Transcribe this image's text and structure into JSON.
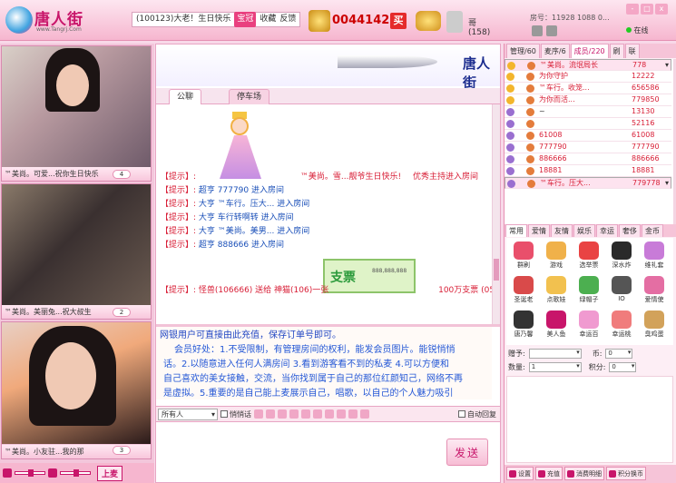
{
  "header": {
    "logo_text": "唐人街",
    "logo_url": "www.Tangrj.Com",
    "notice": "(100123)大老！生日快乐",
    "notice_btn": "宝冠",
    "links": [
      "收藏",
      "反馈"
    ],
    "money": "004414282",
    "buy": "买",
    "username": "哥 (158)",
    "room_info": "房号：11928 1088 0...",
    "status": "在线",
    "win": [
      "-",
      "□",
      "x"
    ]
  },
  "videos": [
    {
      "caption": "™美尚。可爱...祝你生日快乐",
      "count": "4"
    },
    {
      "caption": "™美尚。美丽兔...祝大叔生",
      "count": "2"
    },
    {
      "caption": "™美尚。小友驻...我的那",
      "count": "3"
    }
  ],
  "controls": {
    "mic": "上麦"
  },
  "banner": {
    "title": "唐人街"
  },
  "tabs": [
    "公聊",
    "停车场"
  ],
  "chat": [
    {
      "tip": "【提示】:",
      "text": "™美尚。雪...靓爷生日快乐!",
      "tail": "优秀主持进入房间"
    },
    {
      "tip": "【提示】:",
      "text": "超亨 777790 进入房间"
    },
    {
      "tip": "【提示】:",
      "text": "大亨 ™车行。压大... 进入房间"
    },
    {
      "tip": "【提示】:",
      "text": "大亨 车行转啊转 进入房间"
    },
    {
      "tip": "【提示】:",
      "text": "大亨 ™美尚。美男... 进入房间"
    },
    {
      "tip": "【提示】:",
      "text": "超亨 888666 进入房间"
    },
    {
      "tip": "【提示】:",
      "text": "怪兽(106666) 送给 神猫(106)一张",
      "tail": "100万支票 (05.09 01:45)"
    }
  ],
  "check": {
    "title": "支票",
    "num": "888,888,888"
  },
  "board": {
    "head": "网银用户可直接由此充值，保存订单号即可。",
    "body": [
      "会员好处：1.不受限制，有管理房间的权利，能发会员图片。能锐悄悄",
      "话。2.以随意进入任何人满房间 3.看到游客看不到的私麦 4.可以方便和",
      "自己喜欢的美女接触，交流，当你找到属于自己的那位红颜知己，网络不再",
      "是虚拟。5.重要的是自己能上麦展示自己，唱歌，以自己的个人魅力吸引"
    ]
  },
  "toolbar": {
    "target": "所有人",
    "whisper": "悄悄话",
    "auto": "自动回复"
  },
  "send": "发送",
  "right": {
    "tabs": [
      "管理/60",
      "麦序/6",
      "成员/220",
      "刷",
      "联"
    ],
    "users": [
      {
        "name": "™美尚。流氓局长",
        "id": "778",
        "sel": true
      },
      {
        "name": "为你守护",
        "id": "12222"
      },
      {
        "name": "™车行。收笼...",
        "id": "656586"
      },
      {
        "name": "为你而活...",
        "id": "779850"
      },
      {
        "name": "~",
        "id": "13130",
        "black": true
      },
      {
        "name": "",
        "id": "52116"
      },
      {
        "name": "61008",
        "id": "61008"
      },
      {
        "name": "777790",
        "id": "777790"
      },
      {
        "name": "886666",
        "id": "886666"
      },
      {
        "name": "18881",
        "id": "18881"
      },
      {
        "name": "™车行。压大...",
        "id": "779778",
        "sel": true
      }
    ],
    "gift_tabs": [
      "常用",
      "爱情",
      "友情",
      "娱乐",
      "幸运",
      "奢侈",
      "金币"
    ],
    "gifts": [
      "群刷",
      "游戏",
      "选举票",
      "深水炸",
      "维礼套",
      "圣诞老",
      "点歌娃",
      "绿帽子",
      "IO",
      "爱情使",
      "唐乃馨",
      "美人鱼",
      "幸运百",
      "幸运桃",
      "臭鸡蛋"
    ],
    "gift_form": {
      "to": "赠予:",
      "coin": "币:",
      "qty": "数量:",
      "qty_val": "1",
      "score": "积分:",
      "coin_val": "0",
      "score_val": "0"
    },
    "bottom": [
      "设置",
      "充值",
      "消费明细",
      "积分换币"
    ]
  }
}
